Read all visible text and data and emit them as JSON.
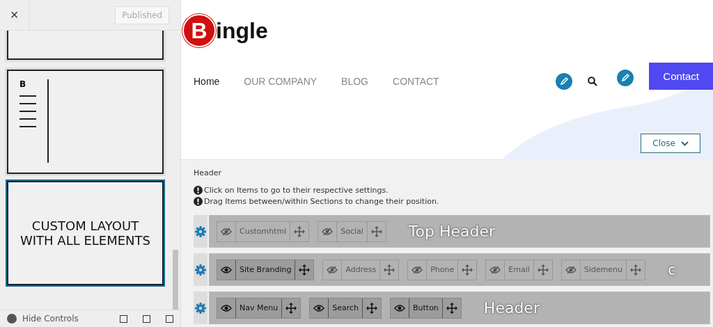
{
  "sidebar": {
    "close": "×",
    "publish_button": {
      "label": "Published",
      "disabled": true
    },
    "layouts": [
      {
        "kind": "blank",
        "selected": false
      },
      {
        "kind": "menu",
        "logo": "B",
        "selected": false
      },
      {
        "kind": "text",
        "label": "CUSTOM LAYOUT WITH ALL ELEMENTS",
        "selected": true
      }
    ],
    "footer": {
      "label": "Hide Controls"
    }
  },
  "preview": {
    "logo_letter": "B",
    "logo_rest": "ingle",
    "nav": [
      {
        "label": "Home",
        "selected": true
      },
      {
        "label": "OUR COMPANY",
        "selected": false
      },
      {
        "label": "BLOG",
        "selected": false
      },
      {
        "label": "CONTACT",
        "selected": false
      }
    ],
    "contact_button": "Contact",
    "close_button": "Close"
  },
  "builder": {
    "title": "Header",
    "notes": [
      "Click on Items to go to their respective settings.",
      "Drag Items between/within Sections to change their position."
    ],
    "rows": [
      {
        "label": "Top Header",
        "items": [
          {
            "name": "Customhtml",
            "visible": false
          },
          {
            "name": "Social",
            "visible": false
          }
        ]
      },
      {
        "label": "c",
        "items": [
          {
            "name": "Site Branding",
            "visible": true
          },
          {
            "name": "Address",
            "visible": false
          },
          {
            "name": "Phone",
            "visible": false
          },
          {
            "name": "Email",
            "visible": false
          },
          {
            "name": "Sidemenu",
            "visible": false
          }
        ]
      },
      {
        "label": "Header",
        "items": [
          {
            "name": "Nav Menu",
            "visible": true
          },
          {
            "name": "Search",
            "visible": true
          },
          {
            "name": "Button",
            "visible": true
          }
        ]
      }
    ]
  }
}
